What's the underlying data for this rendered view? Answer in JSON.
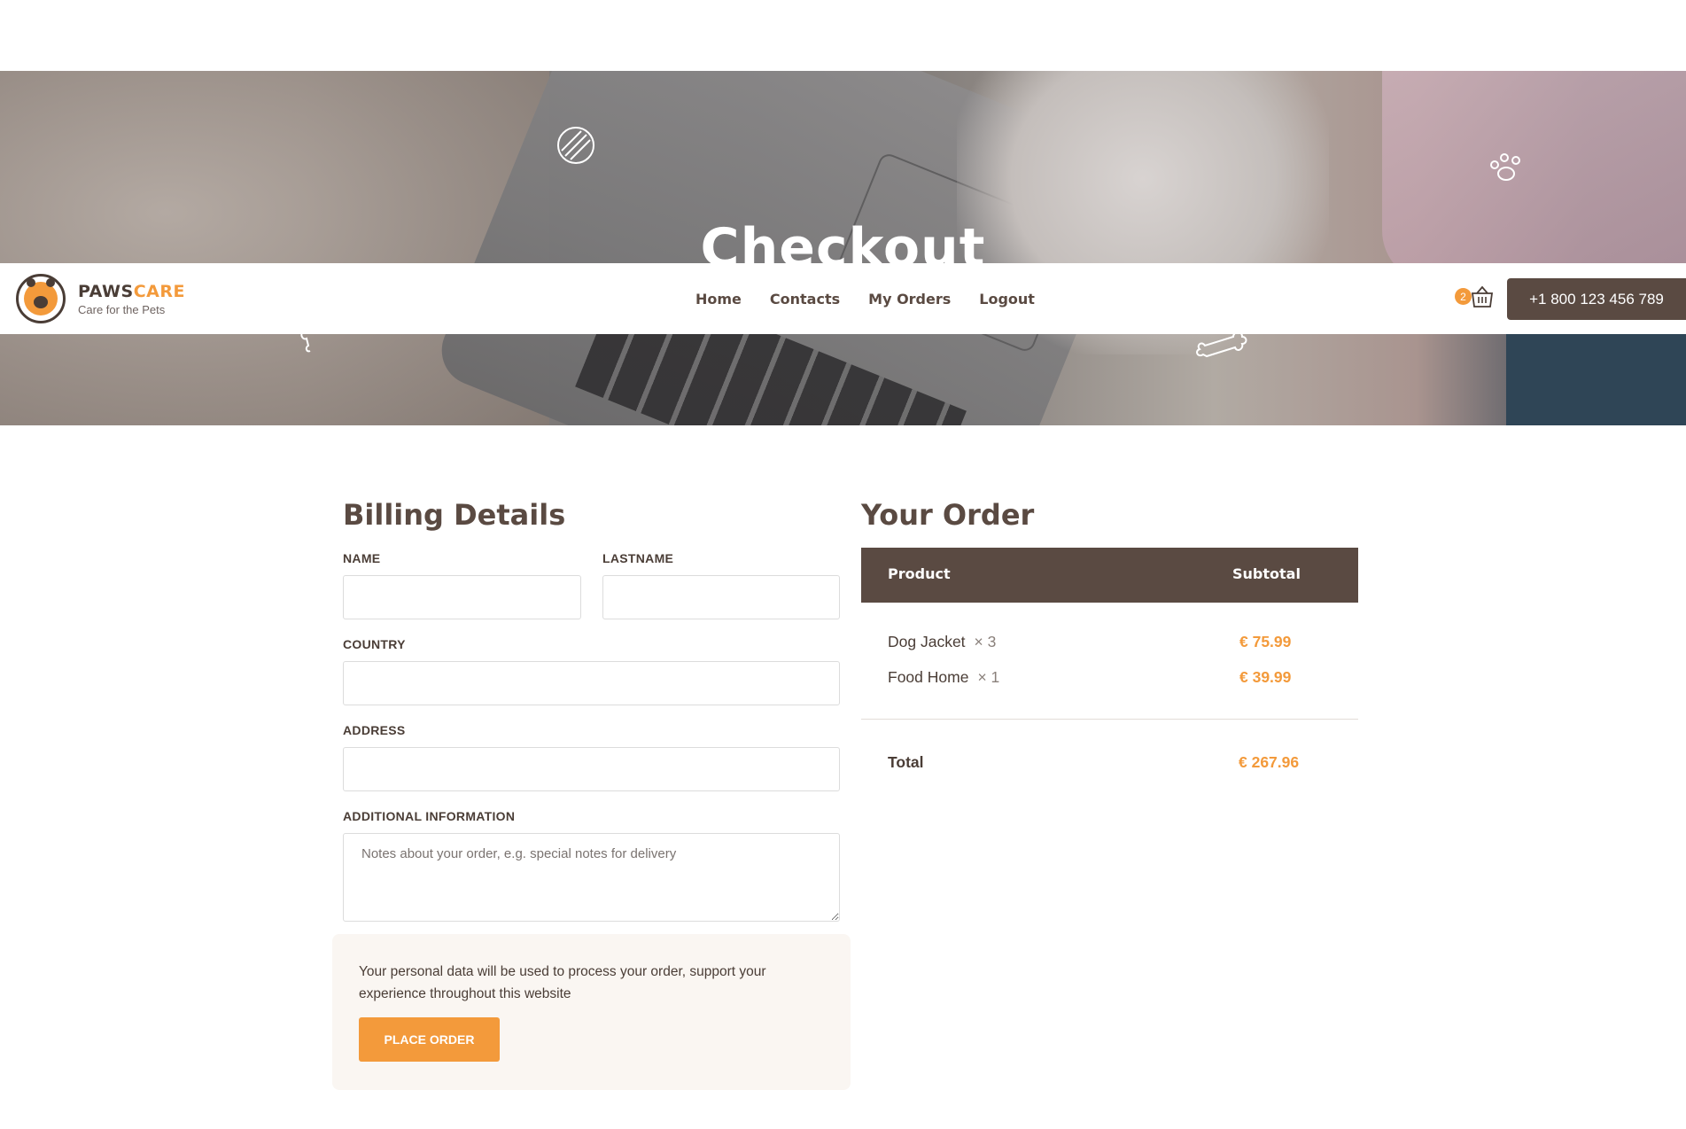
{
  "hero": {
    "title": "Checkout"
  },
  "brand": {
    "name_part1": "PAWS",
    "name_part2": "CARE",
    "tagline": "Care for the Pets"
  },
  "nav": {
    "items": [
      {
        "label": "Home"
      },
      {
        "label": "Contacts"
      },
      {
        "label": "My Orders"
      },
      {
        "label": "Logout"
      }
    ]
  },
  "cart": {
    "count": "2"
  },
  "phone": {
    "label": "+1 800 123 456 789"
  },
  "billing": {
    "title": "Billing Details",
    "name_label": "NAME",
    "lastname_label": "LASTNAME",
    "country_label": "COUNTRY",
    "address_label": "ADDRESS",
    "additional_label": "ADDITIONAL INFORMATION",
    "notes_placeholder": "Notes about your order, e.g. special notes for delivery",
    "privacy_text": "Your personal data will be used to process your order, support your experience throughout this website",
    "place_order_label": "PLACE ORDER"
  },
  "order": {
    "title": "Your Order",
    "col_product": "Product",
    "col_subtotal": "Subtotal",
    "items": [
      {
        "name": "Dog Jacket",
        "qty": "× 3",
        "price": "€ 75.99"
      },
      {
        "name": "Food Home",
        "qty": "× 1",
        "price": "€ 39.99"
      }
    ],
    "total_label": "Total",
    "total_value": "€ 267.96"
  },
  "colors": {
    "accent": "#f39a3b",
    "brand_dark": "#5a4a42",
    "notice_bg": "#faf6f2"
  }
}
